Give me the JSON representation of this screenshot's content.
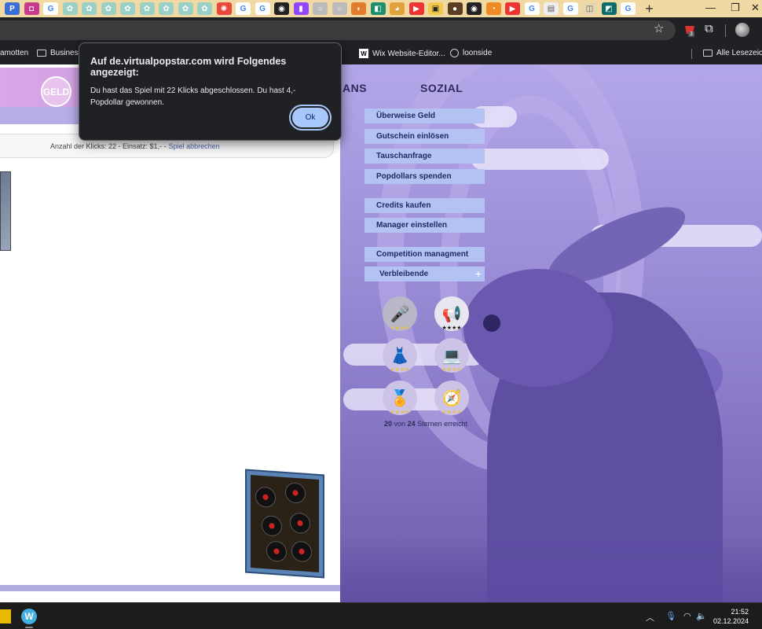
{
  "browser": {
    "bookmarks": [
      {
        "label": "amotten",
        "type": "text"
      },
      {
        "label": "Business",
        "type": "folder"
      },
      {
        "label": "Wix Website-Editor...",
        "type": "wix"
      },
      {
        "label": "loonside",
        "type": "globe"
      }
    ],
    "all_bookmarks_label": "Alle Lesezeiche",
    "extension_badge": "3"
  },
  "dialog": {
    "title": "Auf de.virtualpopstar.com wird Folgendes angezeigt:",
    "message": "Du hast das Spiel mit  22 Klicks abgeschlossen. Du hast  4,- Popdollar gewonnen.",
    "ok_label": "Ok"
  },
  "game": {
    "logo_text": "GELD",
    "info_text": "Anzahl der Klicks: 22 - Einsatz: $1,- -",
    "cancel_label": "Spiel abbrechen"
  },
  "nav": {
    "heading_fans": "ANS",
    "heading_social": "SOZIAL"
  },
  "menu": {
    "items": [
      "Überweise Geld",
      "Gutschein einlösen",
      "Tauschanfrage",
      "Popdollars spenden",
      "Credits kaufen",
      "Manager einstellen",
      "Competition managment",
      "Verbleibende"
    ]
  },
  "badges": {
    "stars_text": "★★★★",
    "earned": "20",
    "total": "24",
    "connector": "von",
    "suffix": "Sternen erreicht",
    "icons": [
      "microphone-icon",
      "megaphone-icon",
      "dress-icon",
      "laptop-icon",
      "medal-icon",
      "compass-icon"
    ]
  },
  "taskbar": {
    "time": "21:52",
    "date": "02.12.2024"
  }
}
